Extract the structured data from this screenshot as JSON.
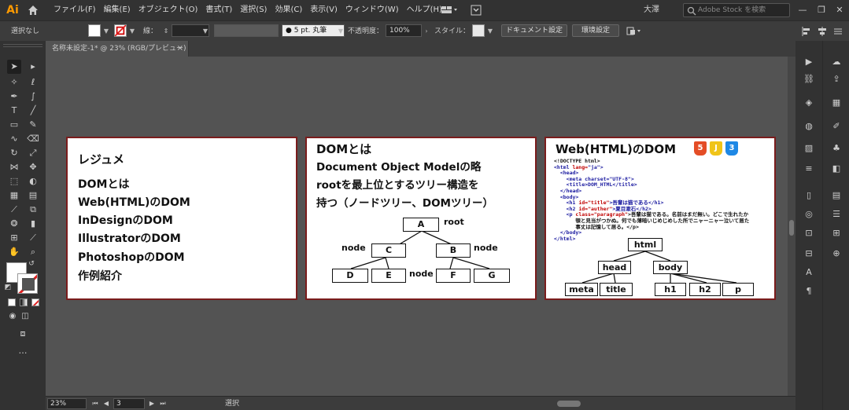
{
  "app": {
    "logo": "Ai"
  },
  "menu": {
    "items": [
      "ファイル(F)",
      "編集(E)",
      "オブジェクト(O)",
      "書式(T)",
      "選択(S)",
      "効果(C)",
      "表示(V)",
      "ウィンドウ(W)",
      "ヘルプ(H)"
    ],
    "user": "大澤",
    "search_placeholder": "Adobe Stock を検索",
    "window_buttons": [
      "—",
      "❐",
      "✕"
    ]
  },
  "control": {
    "selection": "選択なし",
    "stroke_label": "線：",
    "brush": "5 pt. 丸筆",
    "opacity_label": "不透明度：",
    "opacity": "100%",
    "style_label": "スタイル：",
    "doc_settings": "ドキュメント設定",
    "preferences": "環境設定"
  },
  "document": {
    "tab_title": "名称未設定-1* @ 23% (RGB/プレビュー)",
    "close": "×"
  },
  "artboard1": {
    "title": "レジュメ",
    "lines": [
      "DOMとは",
      "Web(HTML)のDOM",
      "InDesignのDOM",
      "IllustratorのDOM",
      "PhotoshopのDOM",
      "作例紹介"
    ]
  },
  "artboard2": {
    "title": "DOMとは",
    "lines": [
      "Document Object Modelの略",
      "rootを最上位とするツリー構造を",
      "持つ（ノードツリー、DOMツリー）"
    ],
    "nodes": {
      "A": "A",
      "B": "B",
      "C": "C",
      "D": "D",
      "E": "E",
      "F": "F",
      "G": "G"
    },
    "labels": {
      "root": "root",
      "node_left": "node",
      "node_right": "node",
      "node_mid": "node"
    }
  },
  "artboard3": {
    "title": "Web(HTML)のDOM",
    "badges": [
      "5",
      "J",
      "3"
    ],
    "badge_colors": [
      "#e44d26",
      "#f0c419",
      "#1e88e5"
    ],
    "code": {
      "l1": "<!DOCTYPE html>",
      "l2a": "<html ",
      "l2b": "lang=",
      "l2c": "\"ja\"",
      "l2d": ">",
      "l3": "  <head>",
      "l4": "    <meta charset=\"UTF-8\">",
      "l5": "    <title>DOM_HTML</title>",
      "l6": "  </head>",
      "l7": "  <body>",
      "l8a": "    <h1 ",
      "l8b": "id=",
      "l8c": "\"title\"",
      "l8d": ">吾輩は猫である</h1>",
      "l9a": "    <h2 ",
      "l9b": "id=",
      "l9c": "\"auther\"",
      "l9d": ">夏目漱石</h2>",
      "l10a": "    <p ",
      "l10b": "class=",
      "l10c": "\"paragraph\"",
      "l10d": ">吾輩は猫である。名前はまだ無い。どこで生れたか",
      "l11": "       頓と見当がつかぬ。何でも薄暗いじめじめした所でニャーニャー泣いて居た",
      "l12": "       事丈は記憶して居る。</p>",
      "l13": "  </body>",
      "l14": "</html>"
    },
    "nodes": {
      "html": "html",
      "head": "head",
      "body": "body",
      "meta": "meta",
      "title": "title",
      "h1": "h1",
      "h2": "h2",
      "p": "p"
    }
  },
  "status": {
    "zoom": "23%",
    "page": "3",
    "tool": "選択"
  }
}
